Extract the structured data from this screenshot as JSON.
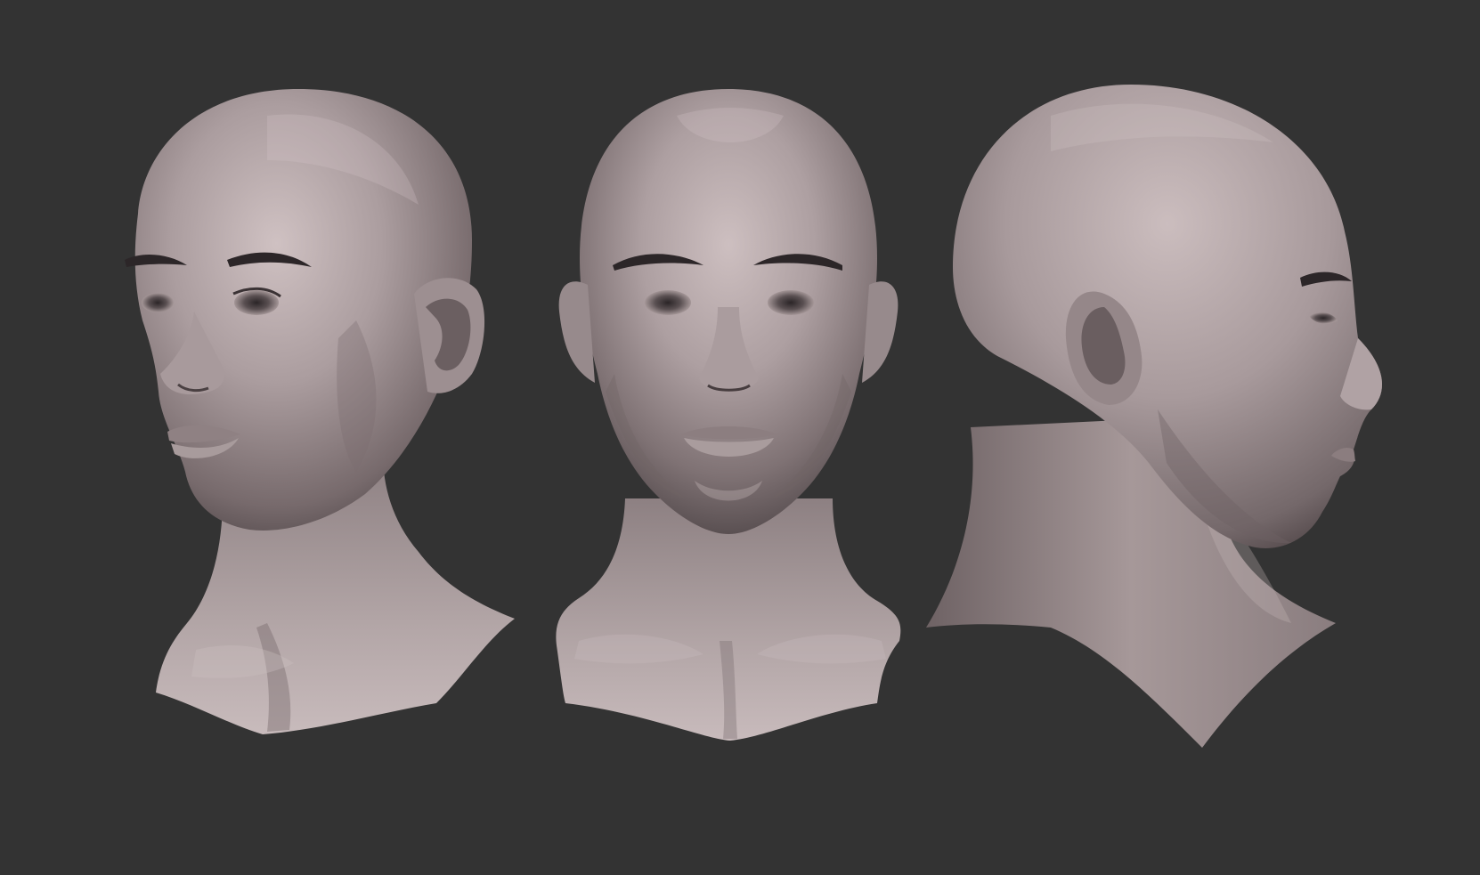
{
  "scene": {
    "background_color": "#333333",
    "clay_color": "#9a8c8e",
    "clay_highlight": "#c9bcbd",
    "clay_shadow": "#4a4244",
    "feature_dark": "#2a2426",
    "views": [
      {
        "id": "three-quarter",
        "view": "three-quarter-left"
      },
      {
        "id": "front",
        "view": "front"
      },
      {
        "id": "profile",
        "view": "right-profile"
      }
    ]
  }
}
